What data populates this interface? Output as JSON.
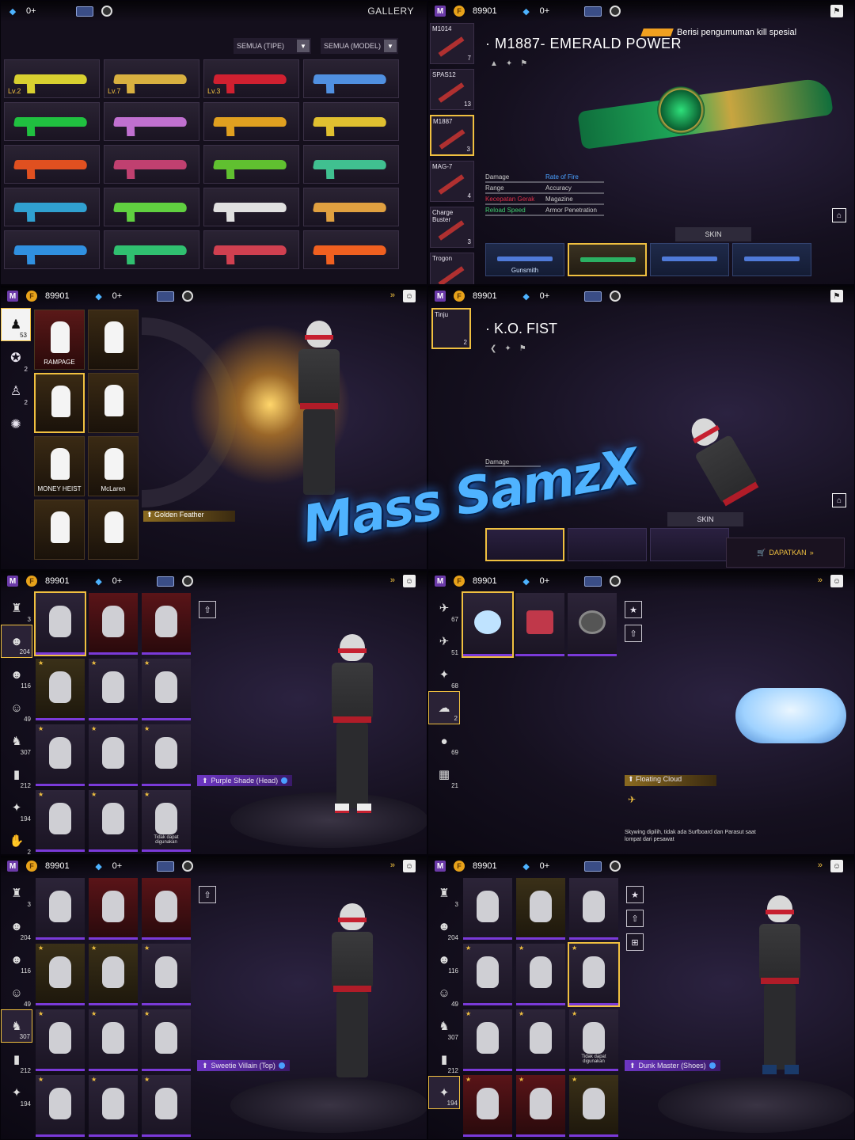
{
  "collage": {
    "topbar": {
      "coins": "89901",
      "gems": "0+",
      "coin_glyph": "F",
      "gem_glyph": "◆",
      "m_glyph": "M"
    },
    "icons": {
      "forward": "»",
      "corner": "⚑",
      "home": "⌂",
      "star": "★",
      "outfit": "⇧",
      "filter": "⊞",
      "pose": "☺"
    },
    "gallery": {
      "title": "GALLERY",
      "filter_type": "SEMUA (TIPE)",
      "filter_model": "SEMUA (MODEL)",
      "dd_glyph": "▼",
      "levels": [
        "Lv.2",
        "Lv.7",
        "Lv.3"
      ],
      "gun_colors": [
        "#d8d030",
        "#d8b040",
        "#d02030",
        "#5090e0",
        "#20c040",
        "#c070d0",
        "#e0a020",
        "#e0c030",
        "#e05020",
        "#c04070",
        "#60c030",
        "#40c090",
        "#30a0d0",
        "#60d040",
        "#e0e0e0",
        "#e0a040",
        "#3090e0",
        "#30c070",
        "#d04050",
        "#f06020"
      ]
    },
    "weapon": {
      "list": [
        {
          "name": "M1014",
          "count": "7"
        },
        {
          "name": "SPAS12",
          "count": "13"
        },
        {
          "name": "M1887",
          "count": "3"
        },
        {
          "name": "MAG-7",
          "count": "4"
        },
        {
          "name": "Charge Buster",
          "count": "3"
        },
        {
          "name": "Trogon",
          "count": ""
        }
      ],
      "title": "M1887- EMERALD POWER",
      "announcement": "Berisi pengumuman kill spesial",
      "stats": [
        {
          "label": "Damage",
          "tone": ""
        },
        {
          "label": "Rate of Fire",
          "tone": "blue"
        },
        {
          "label": "Range",
          "tone": ""
        },
        {
          "label": "Accuracy",
          "tone": ""
        },
        {
          "label": "Kecepatan Gerak",
          "tone": "red"
        },
        {
          "label": "Magazine",
          "tone": ""
        },
        {
          "label": "Reload Speed",
          "tone": "green"
        },
        {
          "label": "Armor Penetration",
          "tone": ""
        }
      ],
      "skin_tab": "SKIN",
      "gunsmith": "Gunsmith"
    },
    "emote": {
      "tab_counts": [
        "53",
        "2",
        "2"
      ],
      "tiles": [
        "RAMPAGE",
        "",
        "",
        "",
        "MONEY HEIST",
        "McLaren",
        "",
        ""
      ],
      "golden_feather": "Golden Feather"
    },
    "fist": {
      "item_name": "Tinju",
      "item_count": "2",
      "title": "K.O. FIST",
      "damage": "Damage",
      "skin_tab": "SKIN",
      "buy": "DAPATKAN"
    },
    "watermark": "Mass SamzX",
    "heads": {
      "tab_counts": [
        "3",
        "204",
        "116",
        "49",
        "307",
        "212",
        "194",
        "2"
      ],
      "label": "Purple Shade (Head)",
      "locked_caption": "Tidak dapat digunakan"
    },
    "vehicles": {
      "tab_counts": [
        "67",
        "51",
        "68",
        "2",
        "69",
        "21"
      ],
      "label": "Floating Cloud",
      "desc": "Skywing dipilih, tidak ada Surfboard dan Parasut saat lompat dari pesawat"
    },
    "tops": {
      "tab_counts": [
        "3",
        "204",
        "116",
        "49",
        "307",
        "212",
        "194"
      ],
      "label": "Sweetie Villain (Top)"
    },
    "shoes": {
      "tab_counts": [
        "3",
        "204",
        "116",
        "49",
        "307",
        "212",
        "194"
      ],
      "label": "Dunk Master (Shoes)",
      "locked_caption": "Tidak dapat digunakan"
    }
  }
}
